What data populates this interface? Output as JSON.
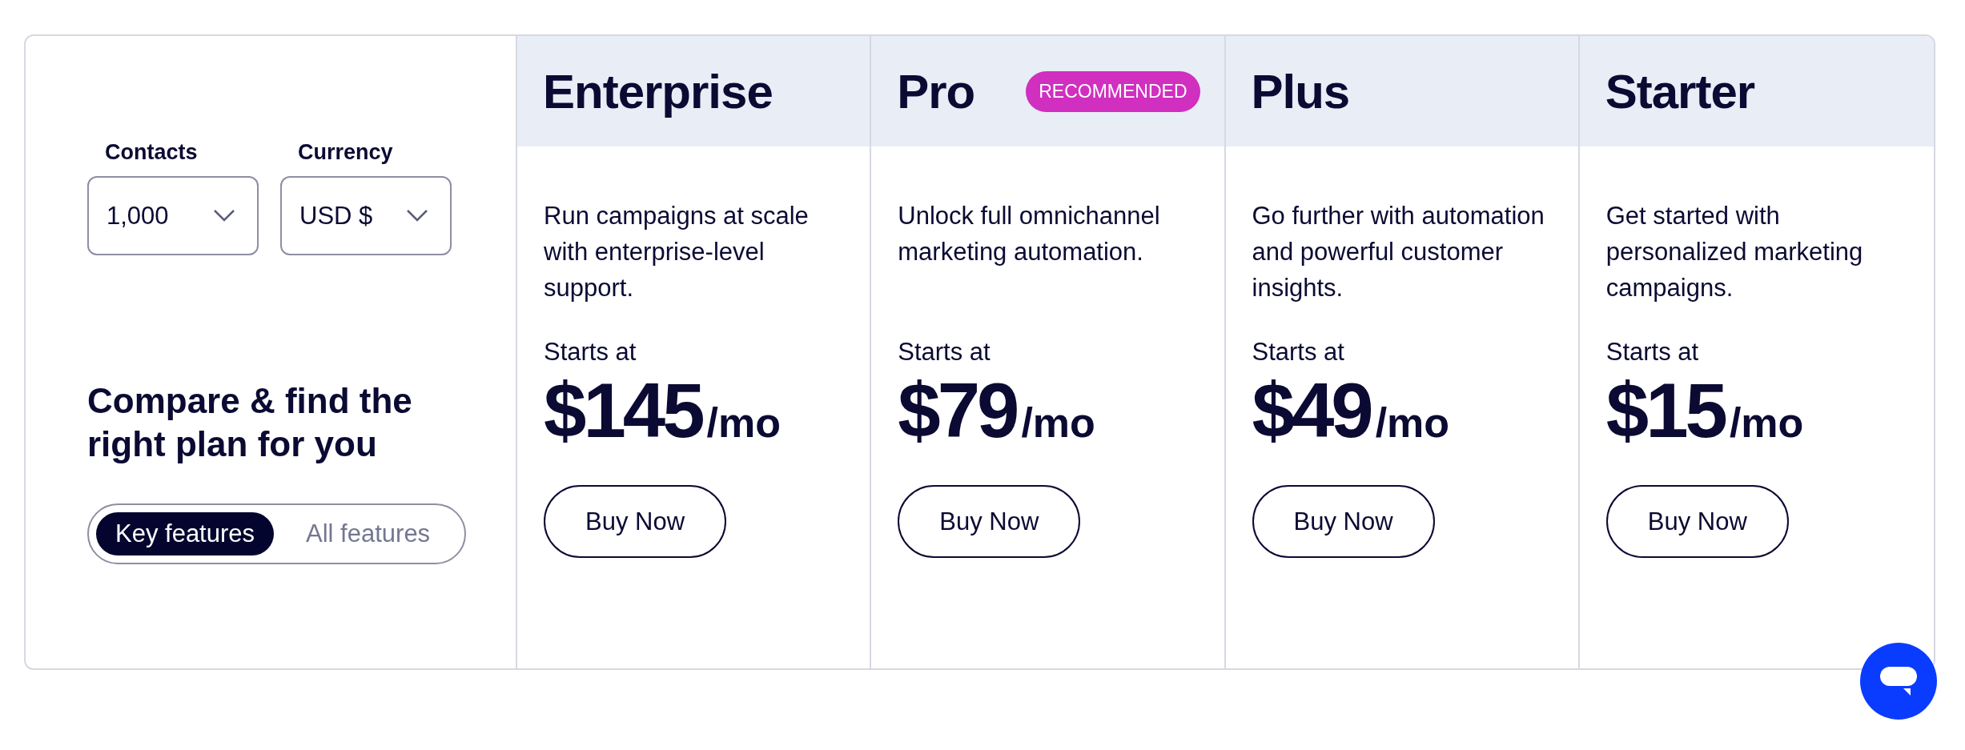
{
  "filters": [
    {
      "label": "Contacts",
      "value": "1,000"
    },
    {
      "label": "Currency",
      "value": "USD $"
    }
  ],
  "heading": "Compare & find the right plan for you",
  "feature_toggle": [
    {
      "label": "Key features",
      "selected": true
    },
    {
      "label": "All features",
      "selected": false
    }
  ],
  "plans": [
    {
      "name": "Enterprise",
      "description": "Run campaigns at scale with enterprise-level support.",
      "starts_label": "Starts at",
      "price": "$145",
      "period": "/mo",
      "button": "Buy Now"
    },
    {
      "name": "Pro",
      "badge": "RECOMMENDED",
      "description": "Unlock full omnichannel marketing automation.",
      "starts_label": "Starts at",
      "price": "$79",
      "period": "/mo",
      "button": "Buy Now"
    },
    {
      "name": "Plus",
      "description": "Go further with automation and powerful customer insights.",
      "starts_label": "Starts at",
      "price": "$49",
      "period": "/mo",
      "button": "Buy Now"
    },
    {
      "name": "Starter",
      "description": "Get started with personalized marketing campaigns.",
      "starts_label": "Starts at",
      "price": "$15",
      "period": "/mo",
      "button": "Buy Now"
    }
  ]
}
